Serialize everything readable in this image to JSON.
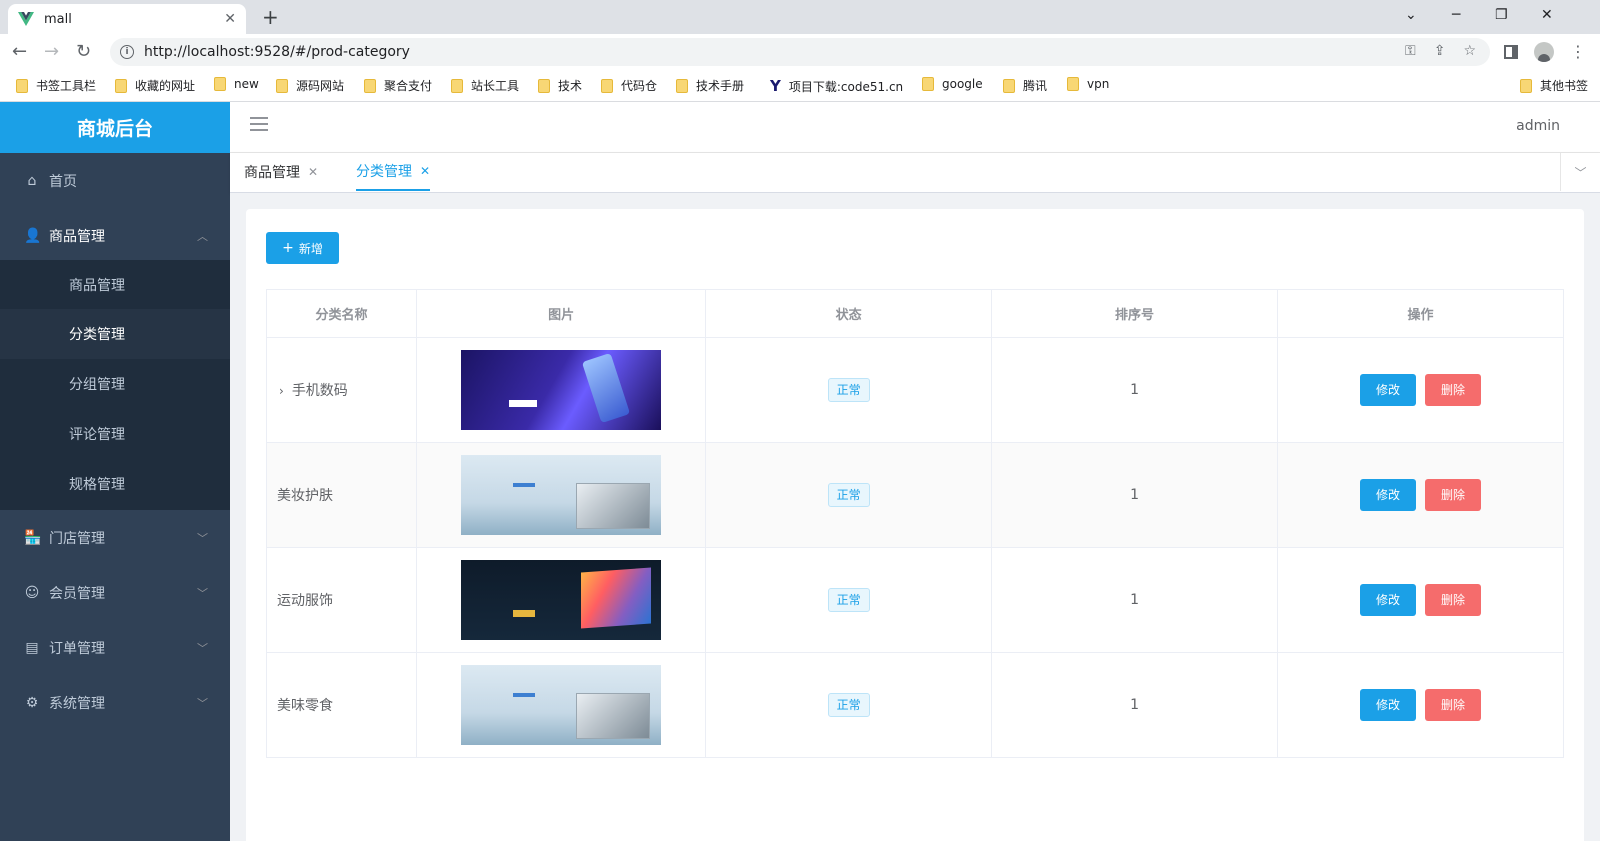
{
  "browser": {
    "tab_title": "mall",
    "url": "http://localhost:9528/#/prod-category",
    "bookmarks": [
      {
        "label": "书签工具栏",
        "icon": "folder"
      },
      {
        "label": "收藏的网址",
        "icon": "folder"
      },
      {
        "label": "new",
        "icon": "folder"
      },
      {
        "label": "源码网站",
        "icon": "folder"
      },
      {
        "label": "聚合支付",
        "icon": "folder"
      },
      {
        "label": "站长工具",
        "icon": "folder"
      },
      {
        "label": "技术",
        "icon": "folder"
      },
      {
        "label": "代码仓",
        "icon": "folder"
      },
      {
        "label": "技术手册",
        "icon": "folder"
      },
      {
        "label": "项目下载:code51.cn",
        "icon": "y-logo"
      },
      {
        "label": "google",
        "icon": "folder"
      },
      {
        "label": "腾讯",
        "icon": "folder"
      },
      {
        "label": "vpn",
        "icon": "folder"
      }
    ],
    "other_bookmarks": "其他书签"
  },
  "app": {
    "title": "商城后台",
    "user": "admin",
    "accent_color": "#1ba0e7",
    "danger_color": "#f56c6c"
  },
  "sidebar": {
    "items": [
      {
        "label": "首页",
        "icon": "home-icon"
      },
      {
        "label": "商品管理",
        "icon": "user-icon",
        "open": true
      },
      {
        "label": "门店管理",
        "icon": "store-icon"
      },
      {
        "label": "会员管理",
        "icon": "member-icon"
      },
      {
        "label": "订单管理",
        "icon": "order-icon"
      },
      {
        "label": "系统管理",
        "icon": "gear-icon"
      }
    ],
    "submenu": [
      {
        "label": "商品管理"
      },
      {
        "label": "分类管理",
        "active": true
      },
      {
        "label": "分组管理"
      },
      {
        "label": "评论管理"
      },
      {
        "label": "规格管理"
      }
    ]
  },
  "tags": [
    {
      "label": "商品管理",
      "active": false
    },
    {
      "label": "分类管理",
      "active": true
    }
  ],
  "toolbar": {
    "add_label": "新增"
  },
  "table": {
    "headers": [
      "分类名称",
      "图片",
      "状态",
      "排序号",
      "操作"
    ],
    "rows": [
      {
        "name": "手机数码",
        "image": "phone-banner",
        "status": "正常",
        "sort": "1",
        "expandable": true
      },
      {
        "name": "美妆护肤",
        "image": "laptop-banner",
        "status": "正常",
        "sort": "1",
        "expandable": false
      },
      {
        "name": "运动服饰",
        "image": "tv-banner",
        "status": "正常",
        "sort": "1",
        "expandable": false
      },
      {
        "name": "美味零食",
        "image": "laptop-banner",
        "status": "正常",
        "sort": "1",
        "expandable": false
      }
    ],
    "edit_label": "修改",
    "delete_label": "删除"
  }
}
